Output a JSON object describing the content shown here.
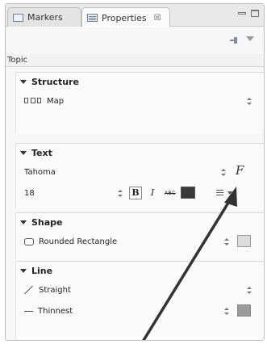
{
  "tabs": [
    {
      "label": "Markers",
      "icon": "markers-icon"
    },
    {
      "label": "Properties",
      "icon": "properties-icon",
      "close": "☒"
    }
  ],
  "topic_label": "Topic",
  "sections": {
    "structure": {
      "title": "Structure",
      "value": "Map"
    },
    "text": {
      "title": "Text",
      "font": "Tahoma",
      "size": "18",
      "font_sample": "F",
      "bold": "B",
      "italic": "I",
      "strike": "ABC",
      "font_color": "#3a3a3a"
    },
    "shape": {
      "title": "Shape",
      "value": "Rounded Rectangle",
      "fill_color": "#dcdcdc"
    },
    "line": {
      "title": "Line",
      "style": "Straight",
      "width": "Thinnest",
      "line_color": "#9b9b9b"
    }
  },
  "annotation_color": "#333333"
}
